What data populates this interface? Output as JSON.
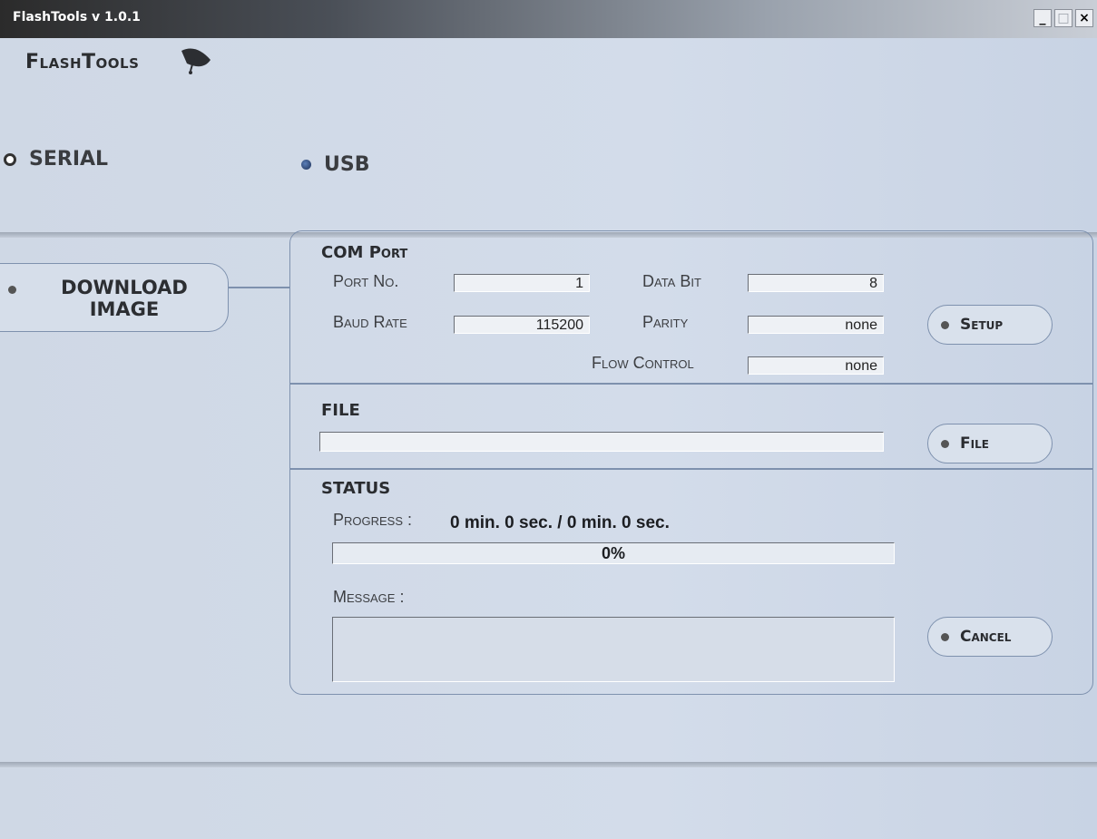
{
  "window": {
    "title": "FlashTools v 1.0.1",
    "minimize": "_",
    "maximize": "□",
    "close": "×"
  },
  "logo": {
    "text": "FlashTools"
  },
  "connection": {
    "serial_label": "SERIAL",
    "usb_label": "USB",
    "selected": "USB"
  },
  "nav": {
    "download_line1": "DOWNLOAD",
    "download_line2": "IMAGE"
  },
  "com_port": {
    "title_bold": "COM",
    "title_rest": "Port",
    "port_no_label": "Port No.",
    "port_no_value": "1",
    "baud_rate_label": "Baud Rate",
    "baud_rate_value": "115200",
    "data_bit_label": "Data Bit",
    "data_bit_value": "8",
    "parity_label": "Parity",
    "parity_value": "none",
    "flow_control_label": "Flow Control",
    "flow_control_value": "none",
    "setup_button": "Setup"
  },
  "file": {
    "title": "FILE",
    "path_value": "",
    "file_button": "File"
  },
  "status": {
    "title": "STATUS",
    "progress_label": "Progress",
    "progress_sep": " : ",
    "progress_time": "0 min. 0 sec. / 0 min. 0 sec.",
    "progress_percent_text": "0%",
    "progress_fraction": 0,
    "message_label": "Message :",
    "message_value": "",
    "cancel_button": "Cancel"
  }
}
